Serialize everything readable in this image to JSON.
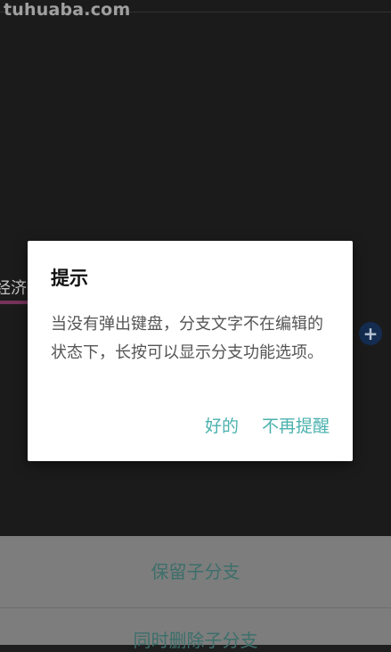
{
  "watermark": "tuhuaba.com",
  "canvas": {
    "partial_node_text": "经济类",
    "add_icon_glyph": "+"
  },
  "dialog": {
    "title": "提示",
    "message": "当没有弹出键盘，分支文字不在编辑的状态下，长按可以显示分支功能选项。",
    "ok_label": "好的",
    "dont_remind_label": "不再提醒"
  },
  "bottom_sheet": {
    "keep_children_label": "保留子分支",
    "delete_children_label": "同时删除子分支"
  },
  "colors": {
    "accent": "#4ab1ad",
    "sheet_text": "#3c6f6a",
    "node_underline": "#8a3d6b",
    "add_icon_bg": "#17345e"
  }
}
